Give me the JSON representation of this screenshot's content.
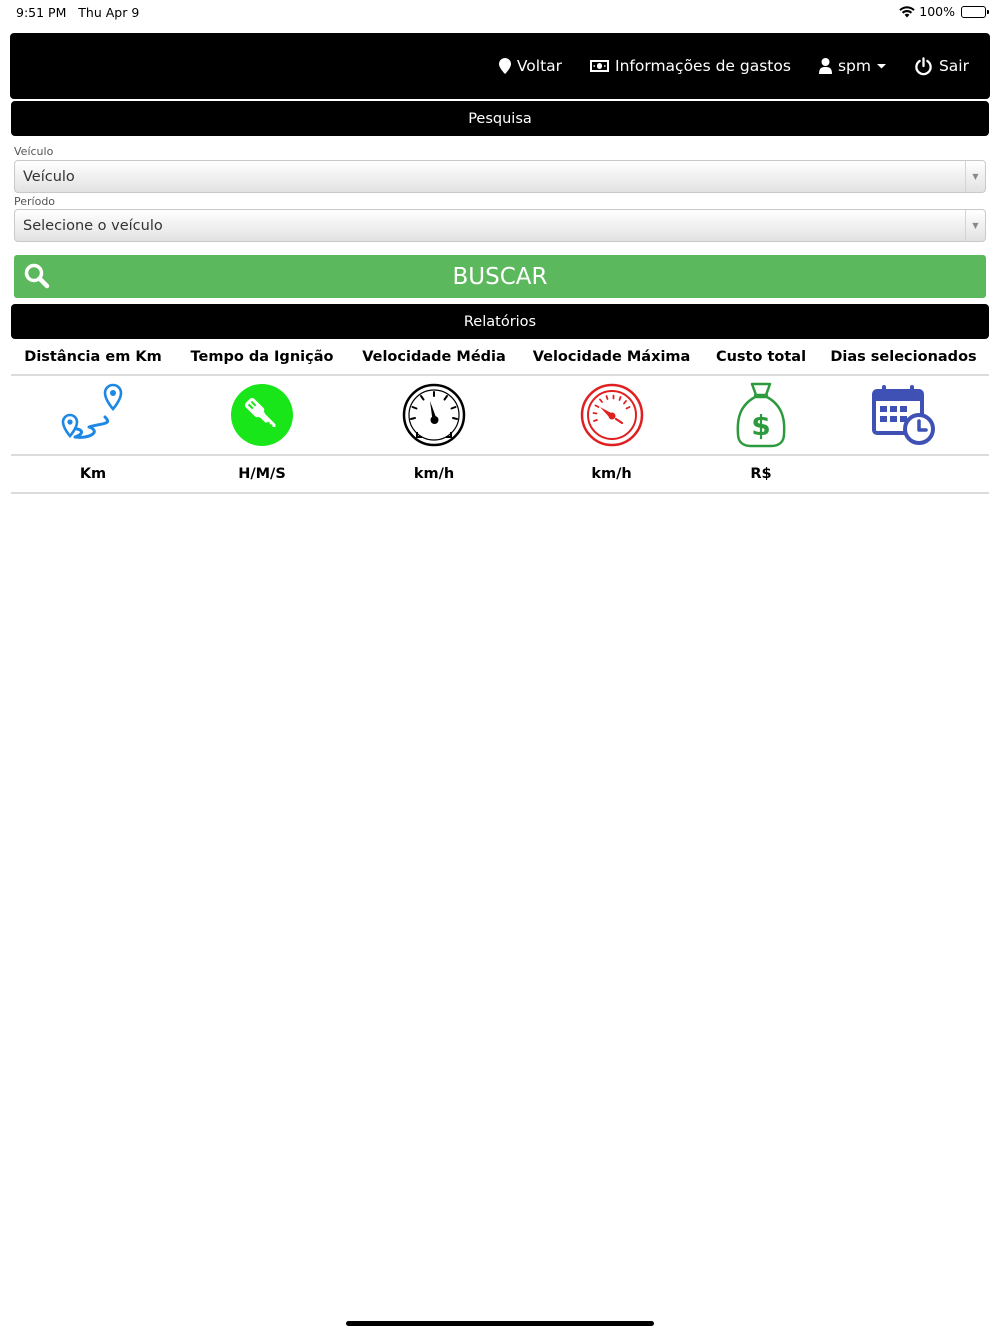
{
  "status_bar": {
    "time": "9:51 PM",
    "date": "Thu Apr 9",
    "battery": "100%"
  },
  "navbar": {
    "back_label": "Voltar",
    "expenses_label": "Informações de gastos",
    "user_label": "spm",
    "logout_label": "Sair"
  },
  "search": {
    "section_title": "Pesquisa",
    "vehicle_label": "Veículo",
    "vehicle_value": "Veículo",
    "period_label": "Período",
    "period_value": "Selecione o veículo",
    "search_button": "BUSCAR"
  },
  "reports": {
    "section_title": "Relatórios",
    "columns": [
      {
        "header": "Distância em Km",
        "icon": "map-route-icon",
        "unit": "Km",
        "color": "#1e88e5"
      },
      {
        "header": "Tempo da Ignição",
        "icon": "ignition-key-icon",
        "unit": "H/M/S",
        "color": "#19e619"
      },
      {
        "header": "Velocidade Média",
        "icon": "speedometer-icon",
        "unit": "km/h",
        "color": "#000000"
      },
      {
        "header": "Velocidade Máxima",
        "icon": "speedometer-max-icon",
        "unit": "km/h",
        "color": "#e02020"
      },
      {
        "header": "Custo total",
        "icon": "money-bag-icon",
        "unit": "R$",
        "color": "#2e9a3e"
      },
      {
        "header": "Dias selecionados",
        "icon": "calendar-clock-icon",
        "unit": "",
        "color": "#3f51b5"
      }
    ]
  }
}
